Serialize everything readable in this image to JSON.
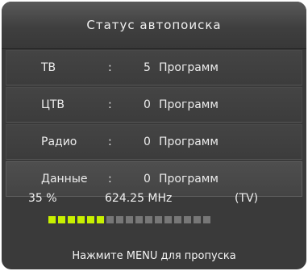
{
  "dialog": {
    "title": "Статус автопоиска"
  },
  "rows": [
    {
      "label": "ТВ",
      "separator": ":",
      "count": "5",
      "unit": "Программ"
    },
    {
      "label": "ЦТВ",
      "separator": ":",
      "count": "0",
      "unit": "Программ"
    },
    {
      "label": "Радио",
      "separator": ":",
      "count": "0",
      "unit": "Программ"
    },
    {
      "label": "Данные",
      "separator": ":",
      "count": "0",
      "unit": "Программ"
    }
  ],
  "status": {
    "percent": "35 %",
    "frequency": "624.25 MHz",
    "mode": "(TV)"
  },
  "progress": {
    "fraction": 0.35,
    "total_segments": 17,
    "filled_color": "#c8f000",
    "empty_color": "#777777"
  },
  "hint": "Нажмите MENU для пропуска"
}
